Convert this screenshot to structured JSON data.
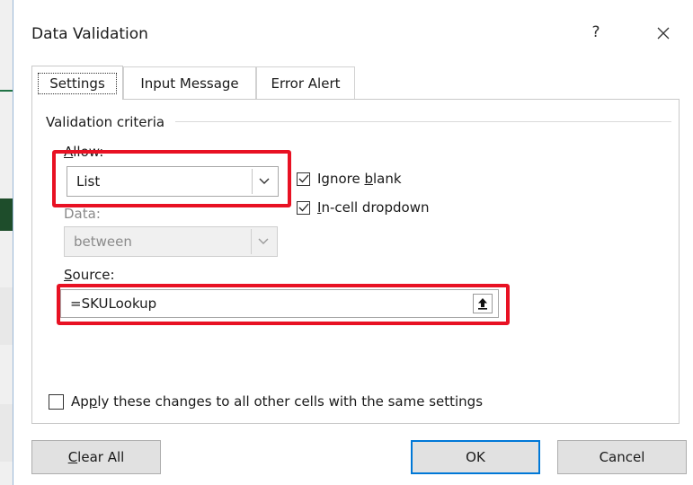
{
  "dialog": {
    "title": "Data Validation",
    "help_glyph": "?",
    "close_glyph": "✕"
  },
  "tabs": [
    {
      "label": "Settings",
      "active": true
    },
    {
      "label": "Input Message",
      "active": false
    },
    {
      "label": "Error Alert",
      "active": false
    }
  ],
  "settings": {
    "criteria_label": "Validation criteria",
    "allow": {
      "label_mnemonic": "A",
      "label_rest": "llow:",
      "value": "List"
    },
    "data": {
      "label": "Data:",
      "value": "between",
      "disabled": true
    },
    "ignore_blank": {
      "label_pre": "Ignore ",
      "label_mnemonic": "b",
      "label_rest": "lank",
      "checked": true
    },
    "in_cell_dropdown": {
      "label_mnemonic": "I",
      "label_rest": "n-cell dropdown",
      "checked": true
    },
    "source": {
      "label_mnemonic": "S",
      "label_rest": "ource:",
      "value": "=SKULookup"
    },
    "apply_all": {
      "label_pre": "Ap",
      "label_mnemonic": "p",
      "label_rest": "ly these changes to all other cells with the same settings",
      "checked": false
    }
  },
  "buttons": {
    "clear_all": {
      "label_mnemonic": "C",
      "label_rest": "lear All"
    },
    "ok": "OK",
    "cancel": "Cancel"
  },
  "colors": {
    "highlight": "#e81123",
    "default_button_border": "#0078d7",
    "excel_green": "#217346"
  }
}
